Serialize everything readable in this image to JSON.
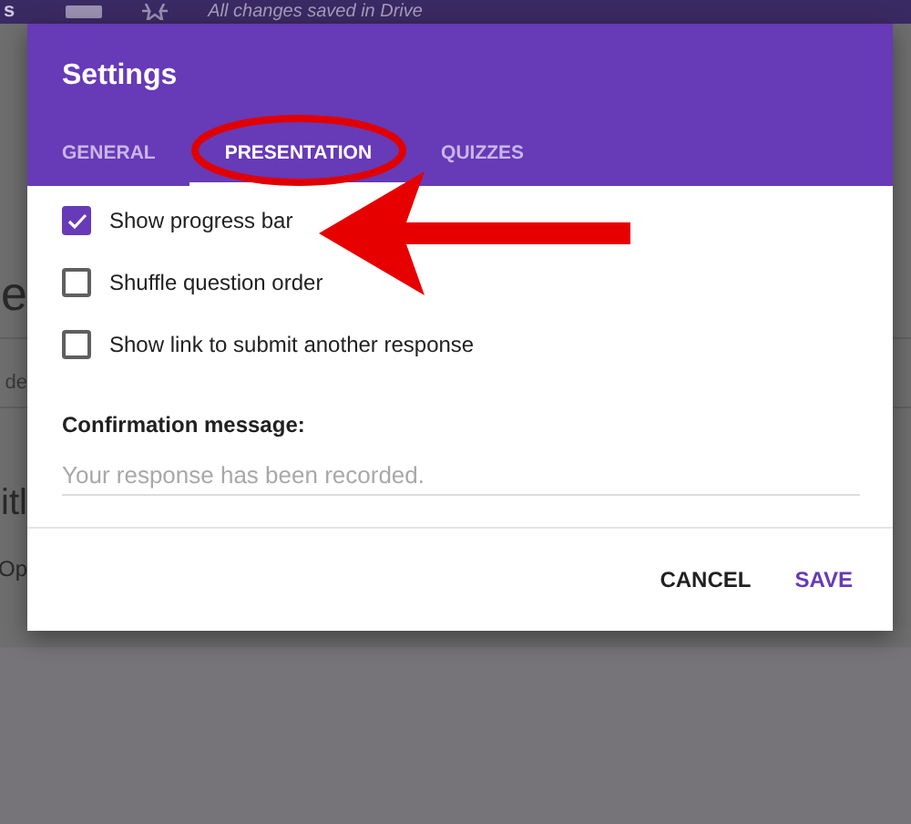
{
  "top_bar": {
    "status": "All changes saved in Drive",
    "fragment": "s"
  },
  "background": {
    "fragments": [
      "e",
      "de",
      "itl",
      "Op"
    ]
  },
  "dialog": {
    "title": "Settings",
    "tabs": [
      {
        "label": "GENERAL",
        "selected": false
      },
      {
        "label": "PRESENTATION",
        "selected": true
      },
      {
        "label": "QUIZZES",
        "selected": false
      }
    ],
    "options": [
      {
        "label": "Show progress bar",
        "checked": true
      },
      {
        "label": "Shuffle question order",
        "checked": false
      },
      {
        "label": "Show link to submit another response",
        "checked": false
      }
    ],
    "confirmation": {
      "label": "Confirmation message:",
      "placeholder": "Your response has been recorded."
    },
    "buttons": [
      {
        "label": "CANCEL",
        "kind": "secondary"
      },
      {
        "label": "SAVE",
        "kind": "primary"
      }
    ]
  }
}
